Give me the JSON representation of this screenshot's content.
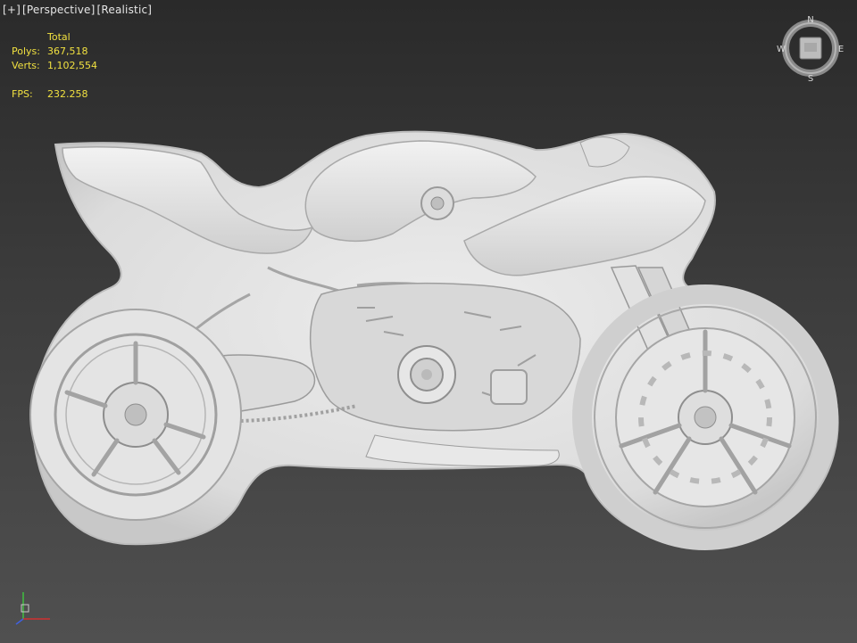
{
  "viewport": {
    "labels": [
      "[+]",
      "[Perspective]",
      "[Realistic]"
    ]
  },
  "stats": {
    "header": "Total",
    "polys_label": "Polys:",
    "polys_value": "367,518",
    "verts_label": "Verts:",
    "verts_value": "1,102,554",
    "fps_label": "FPS:",
    "fps_value": "232.258"
  },
  "viewcube": {
    "north": "N",
    "south": "S",
    "east": "E",
    "west": "W"
  },
  "colors": {
    "stats_text": "#f0e040",
    "model_fill": "#e2e2e2",
    "background_top": "#2a2a2a",
    "background_bottom": "#505050"
  }
}
